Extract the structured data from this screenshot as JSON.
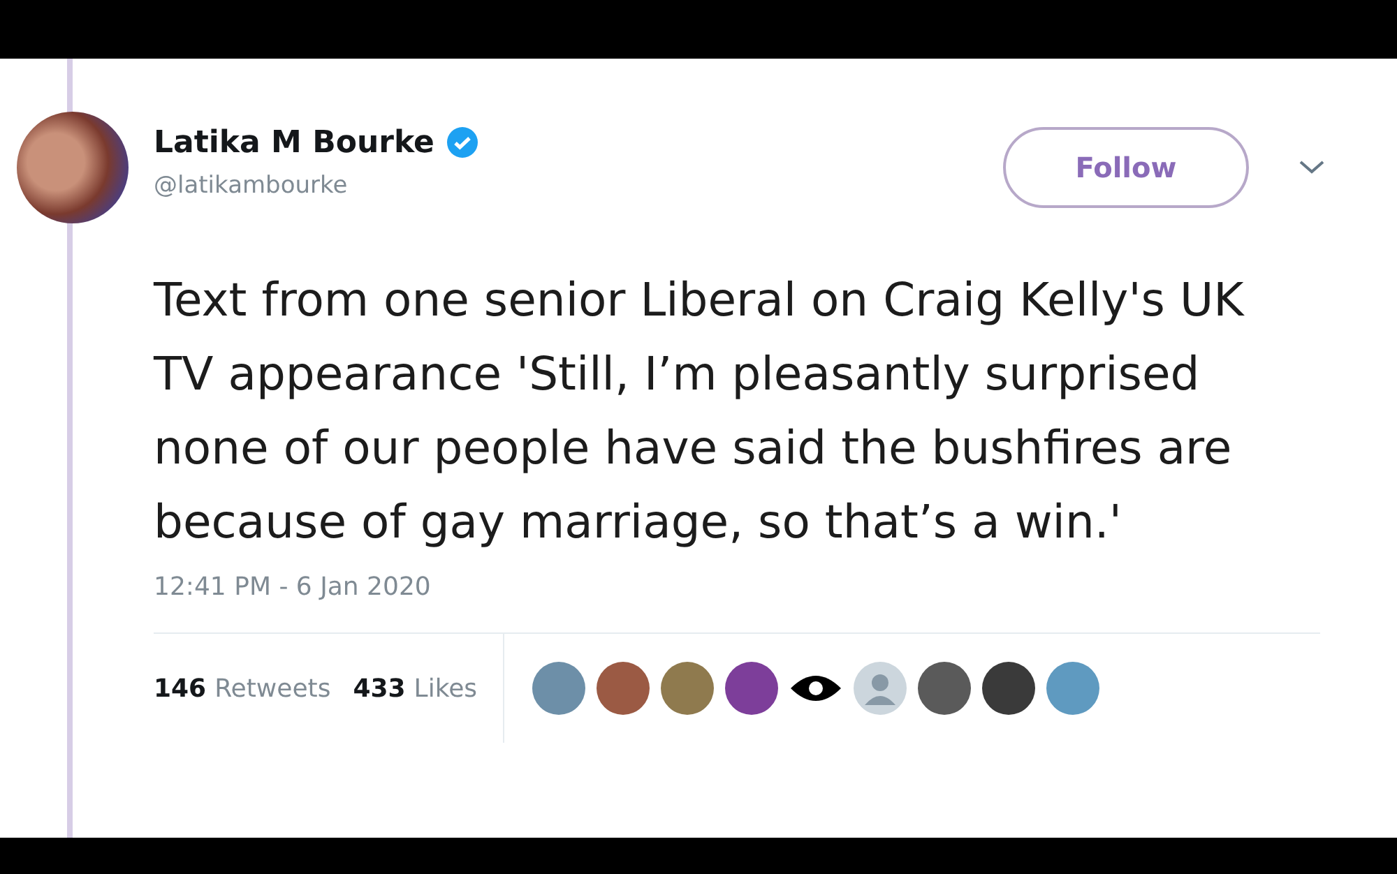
{
  "tweet": {
    "author": {
      "name": "Latika M Bourke",
      "handle": "@latikambourke",
      "verified": true
    },
    "follow_button": {
      "label": "Follow"
    },
    "text": "Text from one senior Liberal on Craig Kelly's UK TV appearance 'Still, I’m pleasantly surprised none of our people have said the bushfires are because of gay marriage, so that’s a win.'",
    "timestamp": "12:41 PM - 6 Jan 2020",
    "stats": [
      {
        "count": "146",
        "label": "Retweets"
      },
      {
        "count": "433",
        "label": "Likes"
      }
    ],
    "liker_avatars": [
      {
        "kind": "photo"
      },
      {
        "kind": "photo"
      },
      {
        "kind": "photo"
      },
      {
        "kind": "photo"
      },
      {
        "kind": "eye"
      },
      {
        "kind": "default"
      },
      {
        "kind": "photo"
      },
      {
        "kind": "photo"
      },
      {
        "kind": "photo"
      }
    ]
  }
}
